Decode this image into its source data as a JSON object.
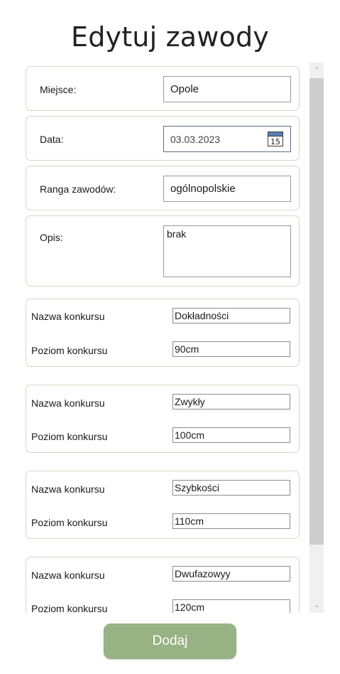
{
  "title": "Edytuj zawody",
  "form": {
    "miejsce_label": "Miejsce:",
    "miejsce_value": "Opole",
    "data_label": "Data:",
    "data_value": "03.03.2023",
    "calendar_day": "15",
    "ranga_label": "Ranga zawodów:",
    "ranga_value": "ogólnopolskie",
    "opis_label": "Opis:",
    "opis_value": "brak"
  },
  "konkursy": [
    {
      "nazwa_label": "Nazwa konkursu",
      "nazwa_value": "Dokładności",
      "poziom_label": "Poziom konkursu",
      "poziom_value": "90cm"
    },
    {
      "nazwa_label": "Nazwa konkursu",
      "nazwa_value": "Zwykły",
      "poziom_label": "Poziom konkursu",
      "poziom_value": "100cm"
    },
    {
      "nazwa_label": "Nazwa konkursu",
      "nazwa_value": "Szybkości",
      "poziom_label": "Poziom konkursu",
      "poziom_value": "110cm"
    },
    {
      "nazwa_label": "Nazwa konkursu",
      "nazwa_value": "Dwufazowyy",
      "poziom_label": "Poziom konkursu",
      "poziom_value": "120cm"
    }
  ],
  "add_button": "Dodaj",
  "colors": {
    "button": "#97b283",
    "card_border": "#d8d6c8",
    "date_border": "#5b6e86"
  }
}
